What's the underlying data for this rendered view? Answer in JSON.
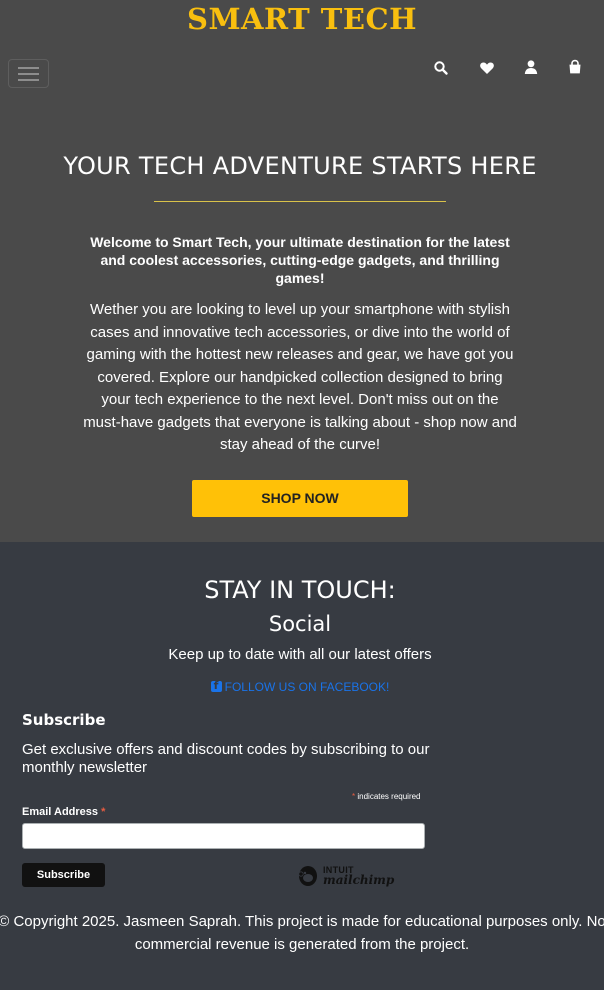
{
  "header": {
    "brand": "SMART TECH",
    "icons": [
      "search-icon",
      "heart-icon",
      "user-icon",
      "shopping-bag-icon"
    ]
  },
  "hero": {
    "title": "YOUR TECH ADVENTURE STARTS HERE",
    "lead": "Welcome to Smart Tech, your ultimate destination for the latest and coolest accessories, cutting-edge gadgets, and thrilling games!",
    "body": "Wether you are looking to level up your smartphone with stylish cases and innovative tech accessories, or dive into the world of gaming with the hottest new releases and gear, we have got you covered. Explore our handpicked collection designed to bring your tech experience to the next level. Don't miss out on the must-have gadgets that everyone is talking about - shop now and stay ahead of the curve!",
    "cta_label": "SHOP NOW"
  },
  "social": {
    "heading": "STAY IN TOUCH:",
    "subheading": "Social",
    "tagline": "Keep up to date with all our latest offers",
    "facebook_link": "FOLLOW US ON FACEBOOK!"
  },
  "newsletter": {
    "title": "Subscribe",
    "description": "Get exclusive offers and discount codes by subscribing to our monthly newsletter",
    "required_star": "*",
    "required_note": "indicates required",
    "email_label": "Email Address",
    "email_value": "",
    "submit_label": "Subscribe",
    "badge_top": "INTUIT",
    "badge_word": "mailchimp"
  },
  "footer": {
    "copyright": "© Copyright 2025. Jasmeen Saprah. This project is made for educational purposes only. No commercial revenue is generated from the project."
  },
  "colors": {
    "brand": "#f9bf0f",
    "header_bg": "#4a4a4a",
    "footer_bg": "#373b42",
    "cta": "#ffc107",
    "link": "#1a73e8",
    "required": "#e85c41"
  }
}
